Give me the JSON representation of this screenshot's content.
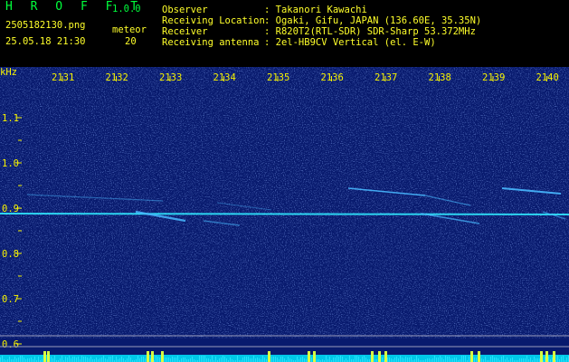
{
  "header": {
    "app_title": "H R O F F T",
    "version": "1.0.0",
    "filename": "2505182130.png",
    "timestamp": "25.05.18 21:30",
    "meteor_label": "meteor",
    "meteor_count": "20",
    "info_labels": [
      "Observer",
      "Receiving Location",
      "Receiver",
      "Receiving antenna"
    ],
    "info_values": [
      ": Takanori Kawachi",
      ": Ogaki, Gifu, JAPAN (136.60E, 35.35N)",
      ": R820T2(RTL-SDR) SDR-Sharp 53.372MHz",
      ": 2el-HB9CV Vertical (el. E-W)"
    ]
  },
  "spectrogram": {
    "y_unit": "kHz",
    "y_ticks": [
      "1.1",
      "1.0",
      "0.9",
      "0.8",
      "0.7",
      "0.6"
    ],
    "x_ticks": [
      "2131",
      "2132",
      "2133",
      "2134",
      "2135",
      "2136",
      "2137",
      "2138",
      "2139",
      "2140"
    ],
    "colors": {
      "background": "#081a6e",
      "signal": "#48b8ff",
      "tick": "#f6f200",
      "baseline": "#30e8ff",
      "bar": "#d8ff40"
    }
  }
}
